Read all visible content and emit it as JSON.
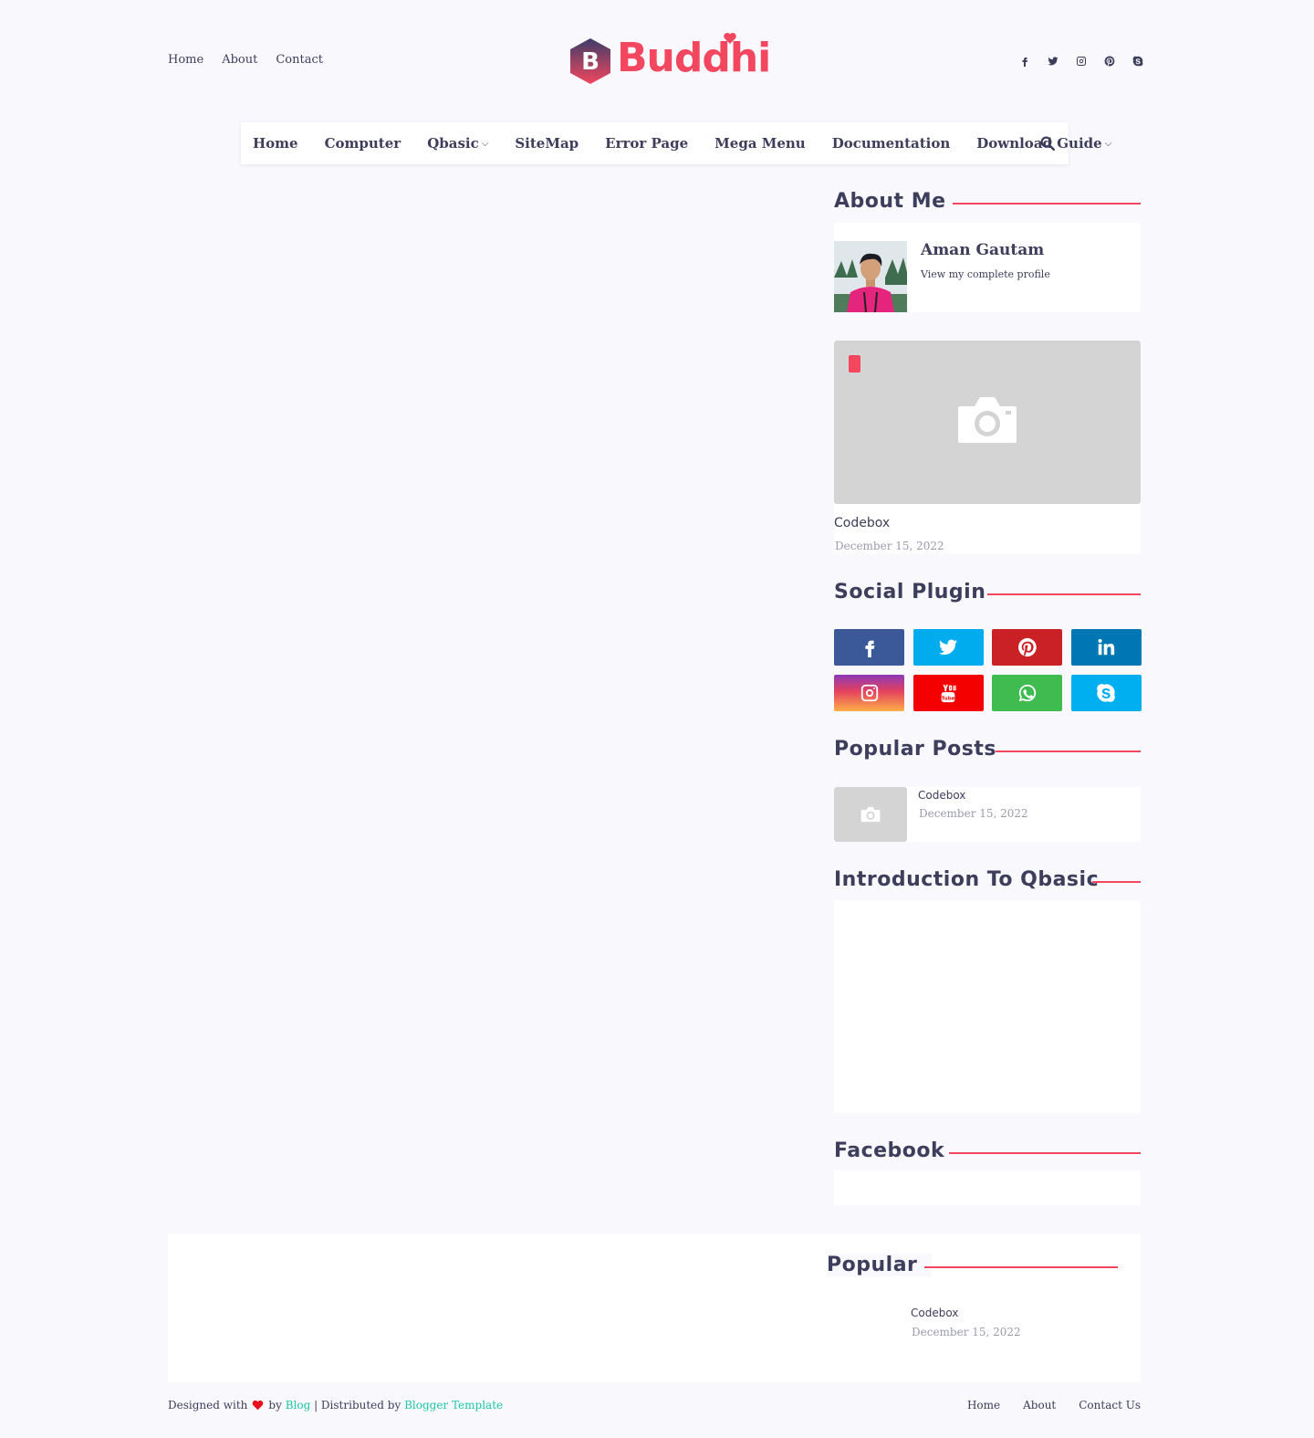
{
  "top_links": [
    "Home",
    "About",
    "Contact"
  ],
  "logo": {
    "letter": "B",
    "word": "Buddhi"
  },
  "top_social_icons": [
    "facebook-icon",
    "twitter-icon",
    "instagram-icon",
    "pinterest-icon",
    "skype-icon"
  ],
  "nav": {
    "items": [
      {
        "label": "Home",
        "dropdown": false
      },
      {
        "label": "Computer",
        "dropdown": false
      },
      {
        "label": "Qbasic",
        "dropdown": true
      },
      {
        "label": "SiteMap",
        "dropdown": false
      },
      {
        "label": "Error Page",
        "dropdown": false
      },
      {
        "label": "Mega Menu",
        "dropdown": false
      },
      {
        "label": "Documentation",
        "dropdown": false
      },
      {
        "label": "Download Guide",
        "dropdown": true
      }
    ],
    "search_icon": "search-icon",
    "chevron": "⌵"
  },
  "about": {
    "title": "About Me",
    "name": "Aman Gautam",
    "link": "View my complete profile"
  },
  "featured": {
    "title": "Codebox",
    "date": "December 15, 2022"
  },
  "social_plugin": {
    "title": "Social Plugin",
    "buttons": [
      {
        "icon": "facebook-icon",
        "color": "#3b5999"
      },
      {
        "icon": "twitter-icon",
        "color": "#00acee"
      },
      {
        "icon": "pinterest-icon",
        "color": "#ca2127"
      },
      {
        "icon": "linkedin-icon",
        "color": "#0077b5"
      },
      {
        "icon": "instagram-icon",
        "color": "#e4405f"
      },
      {
        "icon": "youtube-icon",
        "color": "#f50000"
      },
      {
        "icon": "whatsapp-icon",
        "color": "#3fbb50"
      },
      {
        "icon": "skype-icon",
        "color": "#00aff0"
      }
    ]
  },
  "popular_posts": {
    "title": "Popular Posts",
    "post_title": "Codebox",
    "post_date": "December 15, 2022"
  },
  "intro": {
    "title": "Introduction To Qbasic"
  },
  "facebook": {
    "title": "Facebook"
  },
  "footer_popular": {
    "title": "Popular",
    "post_title": "Codebox",
    "post_date": "December 15, 2022"
  },
  "credits": {
    "designed_with": "Designed with",
    "by": "by",
    "blog": "Blog",
    "distributed": "| Distributed by",
    "template": "Blogger Template"
  },
  "footer_links": [
    "Home",
    "About",
    "Contact Us"
  ],
  "colors": {
    "accent": "#f2475e",
    "text": "#3d3d5c",
    "link": "#1ec6a6",
    "background": "#f8f8fd"
  }
}
